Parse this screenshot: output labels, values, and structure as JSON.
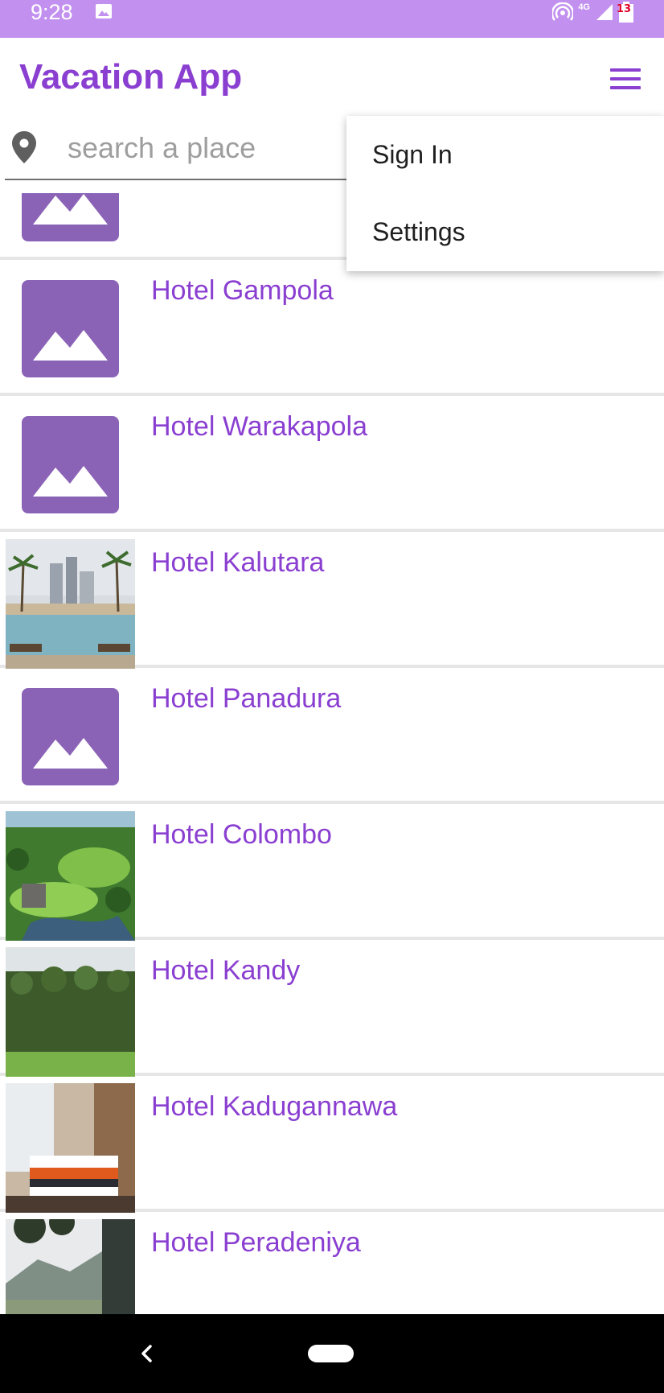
{
  "status_bar": {
    "time": "9:28",
    "network": "4G",
    "battery_level": "13",
    "icons": [
      "gallery-icon",
      "hotspot-icon",
      "signal-icon",
      "battery-icon"
    ]
  },
  "app_bar": {
    "title": "Vacation App",
    "menu_icon": "hamburger-menu-icon"
  },
  "search": {
    "placeholder": "search a place",
    "icon": "location-pin-icon"
  },
  "menu": {
    "items": [
      {
        "label": "Sign In"
      },
      {
        "label": "Settings"
      }
    ]
  },
  "hotels": [
    {
      "name": "",
      "image": "placeholder"
    },
    {
      "name": "Hotel Gampola",
      "image": "placeholder"
    },
    {
      "name": "Hotel Warakapola",
      "image": "placeholder"
    },
    {
      "name": "Hotel Kalutara",
      "image": "pool-photo"
    },
    {
      "name": "Hotel Panadura",
      "image": "placeholder"
    },
    {
      "name": "Hotel Colombo",
      "image": "golf-photo"
    },
    {
      "name": "Hotel Kandy",
      "image": "green-building-photo"
    },
    {
      "name": "Hotel Kadugannawa",
      "image": "room-photo"
    },
    {
      "name": "Hotel Peradeniya",
      "image": "mountain-photo"
    }
  ],
  "colors": {
    "status_bar": "#c290ef",
    "accent": "#8a3fd1",
    "placeholder_tile": "#8a63b7",
    "nav_bar": "#000000"
  },
  "nav_bar": {
    "icons": [
      "back-icon",
      "home-pill-icon"
    ]
  }
}
